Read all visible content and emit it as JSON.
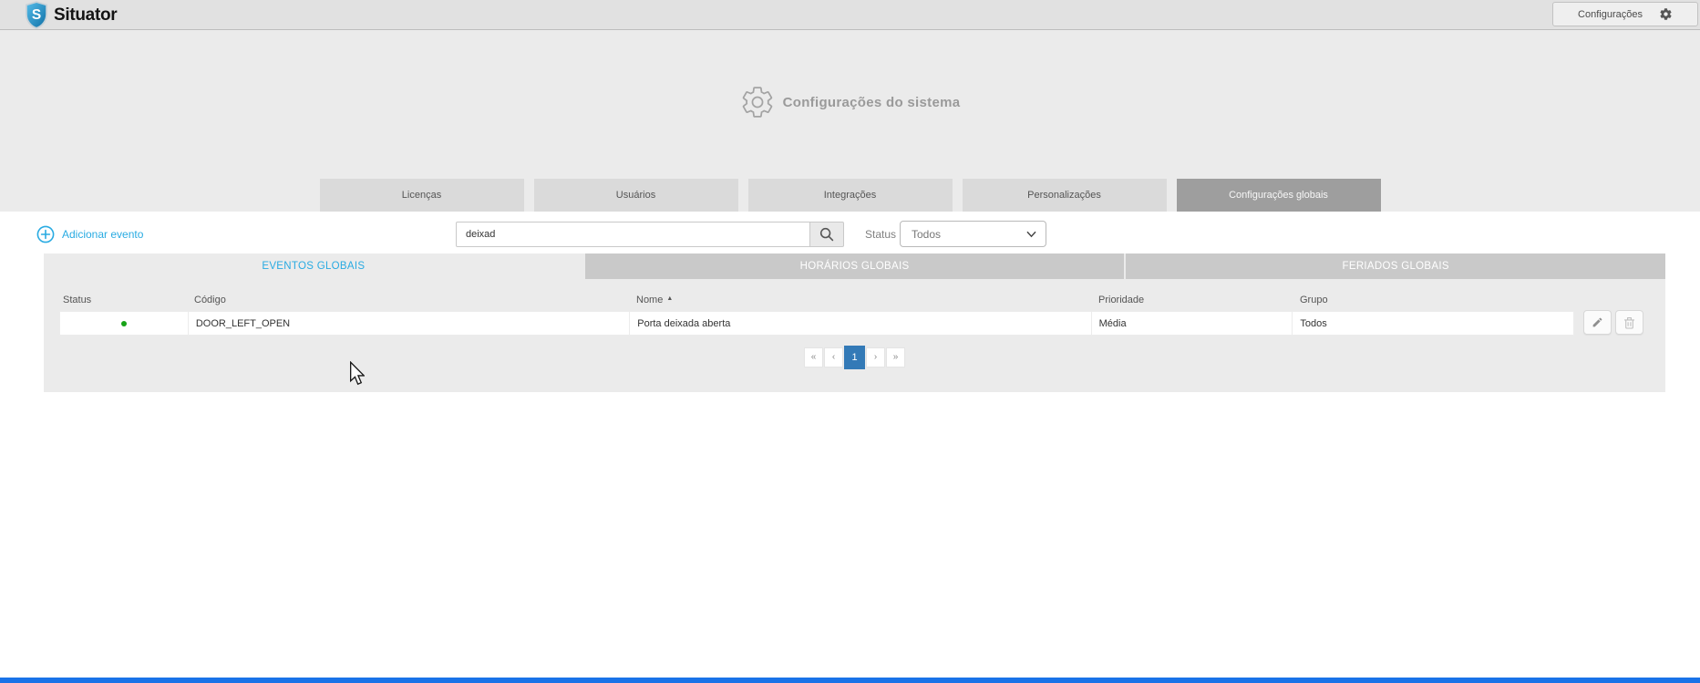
{
  "app": {
    "name": "Situator",
    "logo_letter": "S"
  },
  "topbar": {
    "settings_label": "Configurações"
  },
  "hero": {
    "title": "Configurações do sistema"
  },
  "main_tabs": [
    {
      "label": "Licenças"
    },
    {
      "label": "Usuários"
    },
    {
      "label": "Integrações"
    },
    {
      "label": "Personalizações"
    },
    {
      "label": "Configurações globais"
    }
  ],
  "active_main_tab": "Configurações globais",
  "toolbar": {
    "add_event_label": "Adicionar evento",
    "search_value": "deixad",
    "status_label": "Status",
    "status_value": "Todos"
  },
  "subtabs": [
    {
      "label": "EVENTOS GLOBAIS"
    },
    {
      "label": "HORÁRIOS GLOBAIS"
    },
    {
      "label": "FERIADOS GLOBAIS"
    }
  ],
  "active_subtab": "EVENTOS GLOBAIS",
  "table": {
    "headers": {
      "status": "Status",
      "codigo": "Código",
      "nome": "Nome",
      "prioridade": "Prioridade",
      "grupo": "Grupo"
    },
    "sort": {
      "column": "Nome",
      "direction": "asc",
      "arrow": "▲"
    },
    "rows": [
      {
        "status": "active",
        "codigo": "DOOR_LEFT_OPEN",
        "nome": "Porta deixada aberta",
        "prioridade": "Média",
        "grupo": "Todos"
      }
    ]
  },
  "pagination": {
    "first": "«",
    "prev": "‹",
    "page": "1",
    "active_page": "1",
    "next": "›",
    "last": "»"
  },
  "colors": {
    "accent_blue": "#29abe2",
    "pagination_active_blue": "#337ab7",
    "status_green": "#17a317",
    "bottom_strip_blue": "#1a73e8"
  }
}
